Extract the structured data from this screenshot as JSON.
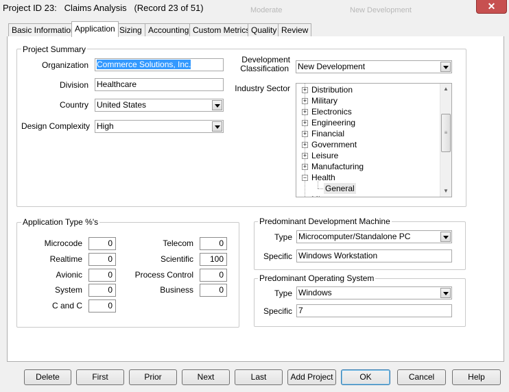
{
  "window": {
    "title": "Project ID 23:   Claims Analysis   (Record 23 of 51)",
    "close_label": "✕",
    "behind_text": [
      "Moderate",
      "New Development"
    ]
  },
  "tabs": [
    {
      "label": "Basic Information"
    },
    {
      "label": "Application",
      "active": true
    },
    {
      "label": "Sizing"
    },
    {
      "label": "Accounting"
    },
    {
      "label": "Custom Metrics"
    },
    {
      "label": "Quality"
    },
    {
      "label": "Review"
    }
  ],
  "project_summary": {
    "legend": "Project Summary",
    "organization": {
      "label": "Organization",
      "value": "Commerce Solutions, Inc."
    },
    "division": {
      "label": "Division",
      "value": "Healthcare"
    },
    "country": {
      "label": "Country",
      "value": "United States"
    },
    "design_complexity": {
      "label": "Design Complexity",
      "value": "High"
    },
    "development_classification": {
      "label_line1": "Development",
      "label_line2": "Classification",
      "value": "New Development"
    },
    "industry_sector": {
      "label": "Industry Sector",
      "items": [
        "Distribution",
        "Military",
        "Electronics",
        "Engineering",
        "Financial",
        "Government",
        "Leisure",
        "Manufacturing",
        "Health"
      ],
      "child": "General",
      "partial": "Mi..."
    }
  },
  "application_type": {
    "legend": "Application Type %'s",
    "left": [
      {
        "label": "Microcode",
        "value": "0"
      },
      {
        "label": "Realtime",
        "value": "0"
      },
      {
        "label": "Avionic",
        "value": "0"
      },
      {
        "label": "System",
        "value": "0"
      },
      {
        "label": "C and C",
        "value": "0"
      }
    ],
    "right": [
      {
        "label": "Telecom",
        "value": "0"
      },
      {
        "label": "Scientific",
        "value": "100"
      },
      {
        "label": "Process Control",
        "value": "0"
      },
      {
        "label": "Business",
        "value": "0"
      }
    ]
  },
  "dev_machine": {
    "legend": "Predominant Development Machine",
    "type_label": "Type",
    "type_value": "Microcomputer/Standalone PC",
    "specific_label": "Specific",
    "specific_value": "Windows Workstation"
  },
  "operating_system": {
    "legend": "Predominant Operating System",
    "type_label": "Type",
    "type_value": "Windows",
    "specific_label": "Specific",
    "specific_value": "7"
  },
  "buttons": [
    "Delete",
    "First",
    "Prior",
    "Next",
    "Last",
    "Add Project",
    "OK",
    "Cancel",
    "Help"
  ]
}
